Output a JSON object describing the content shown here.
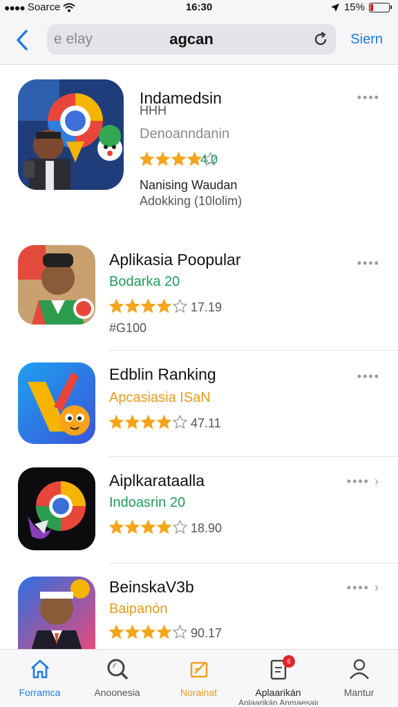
{
  "status": {
    "carrier": "Soarce",
    "time": "16:30",
    "battery": "15%",
    "battery_level": 0.15
  },
  "navbar": {
    "back_icon": "chevron-left-icon",
    "search": {
      "placeholder": "elay",
      "prefix": "e",
      "query": "agcan"
    },
    "reload_icon": "reload-icon",
    "action_label": "Siern"
  },
  "apps": [
    {
      "title": "Indamedsin",
      "title_line2": "HHH",
      "subtitle": "Denoanndanin",
      "subtitle_color": "#8a8a8e",
      "rating": 4,
      "rating_text": "4.0",
      "rating_text_color": "#1d9a5b",
      "meta": [
        "Nanising Waudan",
        "Adokking (10lolim)"
      ]
    },
    {
      "title": "Aplikasia Poopular",
      "subtitle": "Bodarka 20",
      "subtitle_color": "#1d9a5b",
      "rating": 4,
      "rating_text": "17.19",
      "meta": [
        "#G100"
      ]
    },
    {
      "title": "Edblin Ranking",
      "subtitle": "Apcasiasia ISaN",
      "subtitle_color": "#e39a1b",
      "rating": 4,
      "rating_text": "47.11",
      "meta": []
    },
    {
      "title": "Aiplkarataalla",
      "subtitle": "Indoasrin 20",
      "subtitle_color": "#1d9a5b",
      "rating": 4,
      "rating_text": "18.90",
      "meta": []
    },
    {
      "title": "BeinskaV3b",
      "subtitle": "Baipanón",
      "subtitle_color": "#e39a1b",
      "rating": 4,
      "rating_text": "90.17",
      "meta": []
    }
  ],
  "more_label": "••••",
  "tabs": [
    {
      "label": "Forramca",
      "icon": "home-icon",
      "active": true
    },
    {
      "label": "Anoonesia",
      "icon": "search-icon",
      "active": false
    },
    {
      "label": "Norainat",
      "icon": "edit-icon",
      "active": false,
      "highlight": true
    },
    {
      "label": "Aplaarikán",
      "label2": "Aplaarikán Anmaesaina",
      "icon": "apps-icon",
      "active": false,
      "badge": "6"
    },
    {
      "label": "Mantur",
      "icon": "account-icon",
      "active": false
    }
  ],
  "colors": {
    "accent": "#1e7be0",
    "star": "#f4a51c",
    "green": "#1d9a5b",
    "orange": "#e39a1b"
  }
}
